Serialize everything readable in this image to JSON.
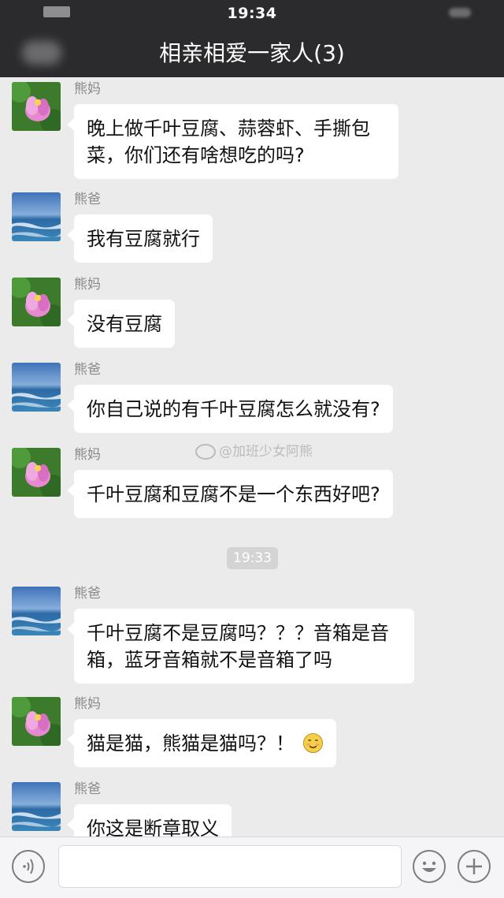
{
  "status_bar": {
    "time": "19:34"
  },
  "header": {
    "title": "相亲相爱一家人(3)"
  },
  "watermark": {
    "text": "@加班少女阿熊"
  },
  "time_separator": "19:33",
  "senders": {
    "mom": "熊妈",
    "dad": "熊爸"
  },
  "messages": [
    {
      "sender": "熊妈",
      "text": "晚上做千叶豆腐、蒜蓉虾、手撕包菜，你们还有啥想吃的吗?"
    },
    {
      "sender": "熊爸",
      "text": "我有豆腐就行"
    },
    {
      "sender": "熊妈",
      "text": "没有豆腐"
    },
    {
      "sender": "熊爸",
      "text": "你自己说的有千叶豆腐怎么就没有?"
    },
    {
      "sender": "熊妈",
      "text": "千叶豆腐和豆腐不是一个东西好吧?"
    },
    {
      "sender": "熊爸",
      "text": "千叶豆腐不是豆腐吗？？？音箱是音箱，蓝牙音箱就不是音箱了吗"
    },
    {
      "sender": "熊妈",
      "text": "猫是猫，熊猫是猫吗？！"
    },
    {
      "sender": "熊爸",
      "text": "你这是断章取义"
    }
  ],
  "icons": {
    "voice": "voice-icon",
    "emoji": "smiley-icon",
    "plus": "plus-icon",
    "message_emoji": "smile-emoji-icon"
  },
  "colors": {
    "header_bg": "#2b2b2d",
    "chat_bg": "#ebebeb",
    "bubble_bg": "#ffffff"
  }
}
